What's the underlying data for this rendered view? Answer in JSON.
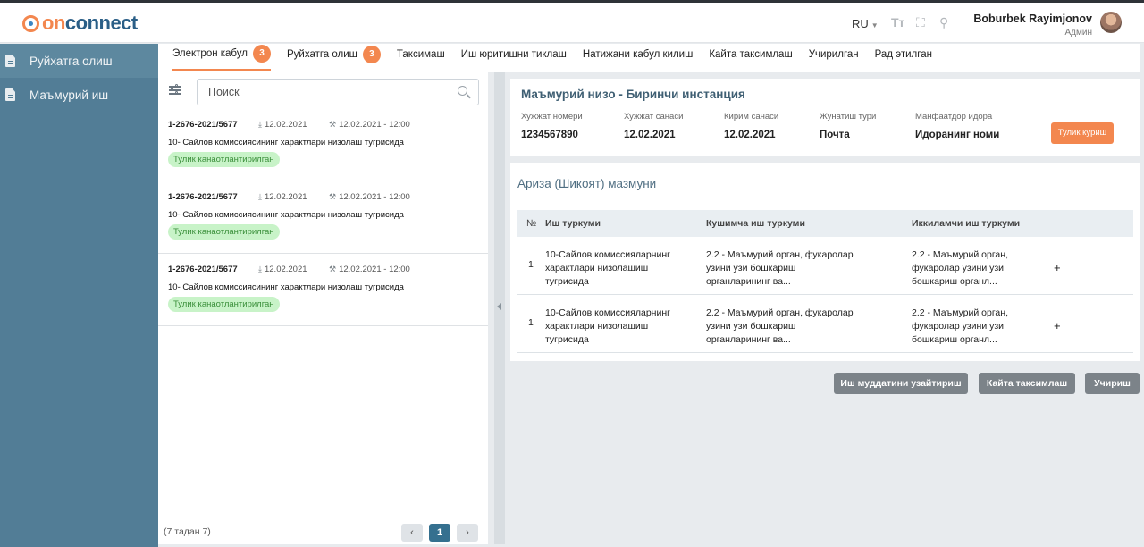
{
  "brand": {
    "logo_on": "on",
    "logo_connect": "connect"
  },
  "header": {
    "language": "RU",
    "user_name": "Boburbek Rayimjonov",
    "user_role": "Админ"
  },
  "sidebar": {
    "items": [
      {
        "label": "Руйхатга олиш"
      },
      {
        "label": "Маъмурий иш"
      }
    ]
  },
  "tabs": [
    {
      "label": "Электрон кабул",
      "badge": "3"
    },
    {
      "label": "Руйхатга олиш",
      "badge": "3"
    },
    {
      "label": "Таксимаш"
    },
    {
      "label": "Иш юритишни тиклаш"
    },
    {
      "label": "Натижани кабул килиш"
    },
    {
      "label": "Кайта таксимлаш"
    },
    {
      "label": "Учирилган"
    },
    {
      "label": "Рад этилган"
    }
  ],
  "search": {
    "placeholder": "Поиск"
  },
  "cards": [
    {
      "number": "1-2676-2021/5677",
      "received": "12.02.2021",
      "hearing": "12.02.2021 - 12:00",
      "title": "10- Сайлов комиссиясининг характлари низолаш тугрисида",
      "status": "Тулик канаотлантирилган"
    },
    {
      "number": "1-2676-2021/5677",
      "received": "12.02.2021",
      "hearing": "12.02.2021 - 12:00",
      "title": "10- Сайлов комиссиясининг характлари низолаш тугрисида",
      "status": "Тулик канаотлантирилган"
    },
    {
      "number": "1-2676-2021/5677",
      "received": "12.02.2021",
      "hearing": "12.02.2021 - 12:00",
      "title": "10- Сайлов комиссиясининг характлари низолаш тугрисида",
      "status": "Тулик канаотлантирилган"
    }
  ],
  "pager": {
    "count": "(7 тадан 7)",
    "current": "1"
  },
  "info": {
    "title": "Маъмурий низо - Биринчи инстанция",
    "fields": [
      {
        "label": "Хужжат номери",
        "value": "1234567890"
      },
      {
        "label": "Хужжат санаси",
        "value": "12.02.2021"
      },
      {
        "label": "Кирим санаси",
        "value": "12.02.2021"
      },
      {
        "label": "Жунатиш тури",
        "value": "Почта"
      },
      {
        "label": "Манфаатдор идора",
        "value": "Идоранинг номи"
      }
    ],
    "button": "Тулик куриш"
  },
  "complaint": {
    "title": "Ариза (Шикоят) мазмуни",
    "columns": [
      "№",
      "Иш туркуми",
      "Кушимча иш туркуми",
      "Иккиламчи иш туркуми"
    ],
    "rows": [
      {
        "no": "1",
        "type": "10-Сайлов комиссияларнинг характлари низолашиш тугрисида",
        "extra": "2.2 - Маъмурий орган, фукаролар узини узи бошкариш органларининг ва...",
        "secondary": "2.2 - Маъмурий орган, фукаролар узини узи бошкариш органл...",
        "action": "+"
      },
      {
        "no": "1",
        "type": "10-Сайлов комиссияларнинг характлари низолашиш тугрисида",
        "extra": "2.2 - Маъмурий орган, фукаролар узини узи бошкариш органларининг ва...",
        "secondary": "2.2 - Маъмурий орган, фукаролар узини узи бошкариш органл...",
        "action": "+"
      }
    ]
  },
  "actions": {
    "extend": "Иш муддатини узайтириш",
    "redistribute": "Кайта таксимлаш",
    "delete": "Учириш"
  },
  "colors": {
    "accent": "#f3874f",
    "sidebar": "#527d96",
    "status_bg": "#c8f3c8",
    "status_text": "#3a8f3a"
  }
}
